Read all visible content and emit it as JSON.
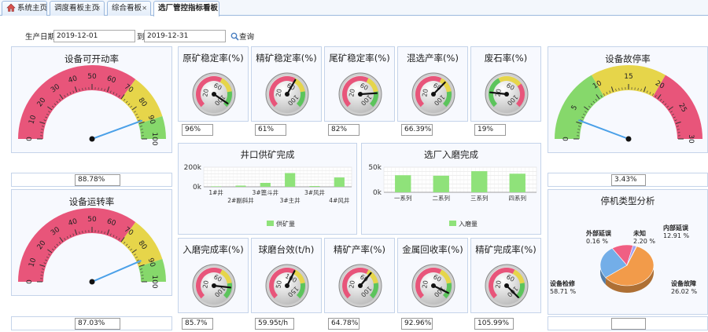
{
  "tabs": [
    {
      "label": "系统主页",
      "closable": false,
      "active": false
    },
    {
      "label": "调度看板主页",
      "closable": true,
      "active": false
    },
    {
      "label": "综合看板",
      "closable": true,
      "active": false
    },
    {
      "label": "选厂管控指标看板",
      "closable": true,
      "active": true
    }
  ],
  "filter": {
    "date_label": "生产日期",
    "start_date": "2019-12-01",
    "to_label": "到",
    "end_date": "2019-12-31",
    "search_label": "查询"
  },
  "big_gauges": [
    {
      "title": "设备可开动率",
      "value_text": "88.78%",
      "value": 88.78,
      "min": 0,
      "max": 100,
      "ticks": [
        0,
        10,
        20,
        30,
        40,
        50,
        60,
        70,
        80,
        90,
        100
      ],
      "bands": [
        {
          "from": 0,
          "to": 70,
          "color": "#e8557a"
        },
        {
          "from": 70,
          "to": 90,
          "color": "#e6d54a"
        },
        {
          "from": 90,
          "to": 100,
          "color": "#86d86b"
        }
      ]
    },
    {
      "title": "设备故停率",
      "value_text": "3.43%",
      "value": 3.43,
      "min": 0,
      "max": 30,
      "ticks": [
        0,
        5,
        10,
        15,
        20,
        25,
        30
      ],
      "bands": [
        {
          "from": 0,
          "to": 10,
          "color": "#86d86b"
        },
        {
          "from": 10,
          "to": 20,
          "color": "#e6d54a"
        },
        {
          "from": 20,
          "to": 30,
          "color": "#e8557a"
        }
      ]
    },
    {
      "title": "设备运转率",
      "value_text": "87.03%",
      "value": 87.03,
      "min": 0,
      "max": 100,
      "ticks": [
        0,
        10,
        20,
        30,
        40,
        50,
        60,
        70,
        80,
        90,
        100
      ],
      "bands": [
        {
          "from": 0,
          "to": 70,
          "color": "#e8557a"
        },
        {
          "from": 70,
          "to": 90,
          "color": "#e6d54a"
        },
        {
          "from": 90,
          "to": 100,
          "color": "#86d86b"
        }
      ]
    }
  ],
  "small_gauges": [
    {
      "title": "原矿稳定率(%)",
      "value_text": "96%",
      "value": 96,
      "max": 100,
      "ticks": [
        "20",
        "60",
        "100"
      ]
    },
    {
      "title": "精矿稳定率(%)",
      "value_text": "61%",
      "value": 61,
      "max": 100,
      "ticks": [
        "20",
        "60",
        "100"
      ]
    },
    {
      "title": "尾矿稳定率(%)",
      "value_text": "82%",
      "value": 82,
      "max": 100,
      "ticks": [
        "20",
        "60",
        "100"
      ]
    },
    {
      "title": "混选产率(%)",
      "value_text": "66.39%",
      "value": 66.39,
      "max": 100,
      "ticks": [
        "20",
        "60",
        "100"
      ]
    },
    {
      "title": "废石率(%)",
      "value_text": "19%",
      "value": 19,
      "max": 100,
      "ticks": [
        "20",
        "60",
        "100"
      ],
      "reversed": true
    },
    {
      "title": "入磨完成率(%)",
      "value_text": "85.7%",
      "value": 85.7,
      "max": 100,
      "ticks": [
        "20",
        "60",
        "100"
      ]
    },
    {
      "title": "球磨台效(t/h)",
      "value_text": "59.95t/h",
      "value": 59.95,
      "max": 100,
      "ticks": [
        "50",
        "100",
        "150"
      ]
    },
    {
      "title": "精矿产率(%)",
      "value_text": "64.78%",
      "value": 64.78,
      "max": 100,
      "ticks": [
        "20",
        "60",
        "100"
      ]
    },
    {
      "title": "金属回收率(%)",
      "value_text": "92.96%",
      "value": 92.96,
      "max": 100,
      "ticks": [
        "20",
        "60",
        "100"
      ]
    },
    {
      "title": "精矿完成率(%)",
      "value_text": "105.99%",
      "value": 105.99,
      "max": 100,
      "ticks": [
        "20",
        "60",
        "100"
      ]
    }
  ],
  "chart_data": [
    {
      "type": "bar",
      "title": "井口供矿完成",
      "categories": [
        "1#井",
        "2#副斜井",
        "3#篦斗井",
        "3#主井",
        "3#风井",
        "4#风井"
      ],
      "series": [
        {
          "name": "供矿量",
          "values": [
            5000,
            12000,
            40000,
            140000,
            8000,
            95000
          ]
        }
      ],
      "y_ticks": [
        "0k",
        "200k"
      ],
      "ylim": [
        0,
        200000
      ],
      "color": "#8fe27a",
      "legend_position": "bottom"
    },
    {
      "type": "bar",
      "title": "选厂入磨完成",
      "categories": [
        "一系列",
        "二系列",
        "三系列",
        "四系列"
      ],
      "series": [
        {
          "name": "入磨量",
          "values": [
            34000,
            33000,
            42000,
            37000
          ]
        }
      ],
      "y_ticks": [
        "0k",
        "50k"
      ],
      "ylim": [
        0,
        50000
      ],
      "color": "#8fe27a",
      "legend_position": "bottom"
    },
    {
      "type": "pie",
      "title": "停机类型分析",
      "slices": [
        {
          "label": "设备检修",
          "percent": "58.71 %",
          "value": 58.71,
          "color": "#f29b4a"
        },
        {
          "label": "设备故障",
          "percent": "26.02 %",
          "value": 26.02,
          "color": "#73aee8"
        },
        {
          "label": "内部延误",
          "percent": "12.91 %",
          "value": 12.91,
          "color": "#f05f83"
        },
        {
          "label": "未知",
          "percent": "2.20 %",
          "value": 2.2,
          "color": "#a3a3f2"
        },
        {
          "label": "外部延误",
          "percent": "0.16 %",
          "value": 0.16,
          "color": "#5fd38a"
        }
      ],
      "value_text": ""
    }
  ]
}
